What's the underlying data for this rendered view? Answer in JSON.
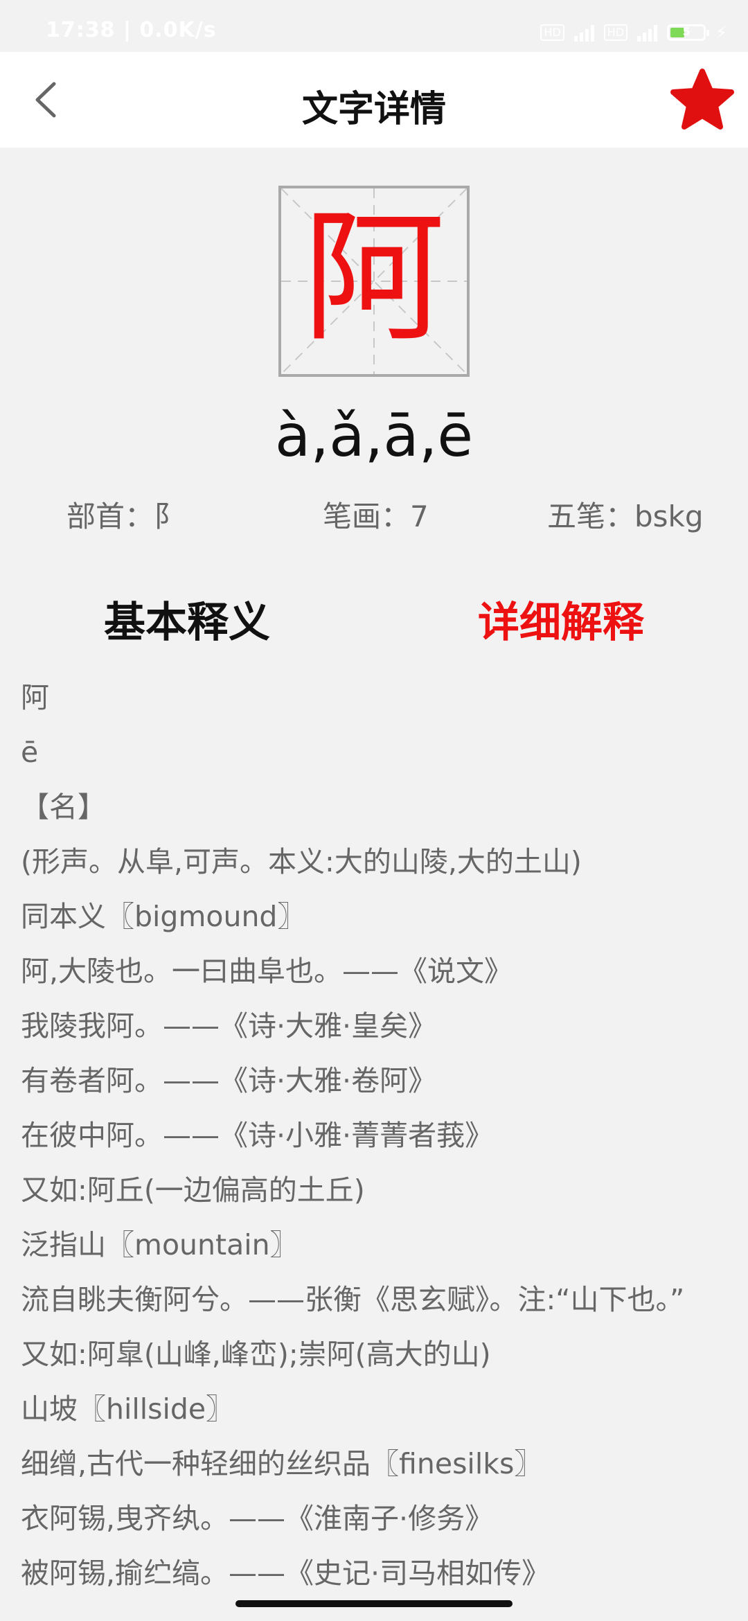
{
  "status_bar": {
    "time": "17:38 | 0.0K/s",
    "hd1": "HD",
    "hd2": "HD",
    "battery": "5"
  },
  "header": {
    "title": "文字详情",
    "back_icon": "chevron-left-icon",
    "favorite_icon": "star-icon",
    "favorite_color": "#e01010"
  },
  "character": {
    "glyph": "阿",
    "pinyin": "à,ǎ,ā,ē",
    "radical": "部首：阝",
    "strokes": "笔画：7",
    "wubi": "五笔：bskg",
    "color": "#ee1111"
  },
  "tabs": {
    "basic": "基本释义",
    "detail": "详细解释"
  },
  "content": {
    "lines": [
      "阿",
      "ē",
      "【名】",
      "(形声。从阜,可声。本义:大的山陵,大的土山)",
      "同本义〖bigmound〗",
      "阿,大陵也。一曰曲阜也。——《说文》",
      "我陵我阿。——《诗·大雅·皇矣》",
      "有卷者阿。——《诗·大雅·卷阿》",
      "在彼中阿。——《诗·小雅·菁菁者莪》",
      "又如:阿丘(一边偏高的土丘)",
      "泛指山〖mountain〗",
      "流自眺夫衡阿兮。——张衡《思玄赋》。注:“山下也。”",
      "又如:阿皐(山峰,峰峦);崇阿(高大的山)",
      "山坡〖hillside〗",
      "细缯,古代一种轻细的丝织品〖finesilks〗",
      "衣阿锡,曳齐纨。——《淮南子·修务》",
      "被阿锡,揄纻缟。——《史记·司马相如传》"
    ]
  }
}
